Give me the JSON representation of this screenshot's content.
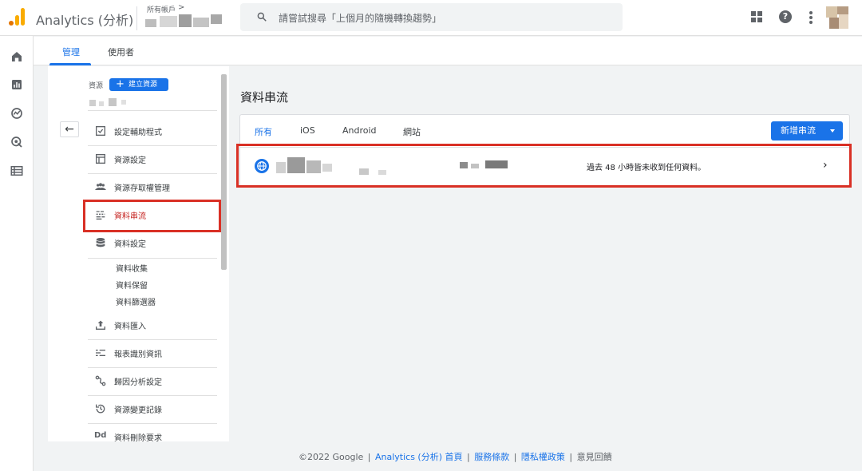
{
  "header": {
    "app_title": "Analytics (分析)",
    "account_label": "所有帳戶",
    "account_chevron": ">",
    "search_placeholder": "請嘗試搜尋「上個月的隨機轉換趨勢」"
  },
  "tabs": [
    {
      "label": "管理",
      "active": true
    },
    {
      "label": "使用者",
      "active": false
    }
  ],
  "property": {
    "label": "資源",
    "create_button": "建立資源",
    "create_icon": "+"
  },
  "back_icon": "←",
  "nav": [
    {
      "label": "設定輔助程式",
      "icon": "checklist-icon"
    },
    {
      "label": "資源設定",
      "icon": "property-settings-icon"
    },
    {
      "label": "資源存取權管理",
      "icon": "people-icon"
    },
    {
      "label": "資料串流",
      "icon": "data-streams-icon",
      "active": true
    },
    {
      "label": "資料設定",
      "icon": "database-icon"
    },
    {
      "label": "資料匯入",
      "icon": "upload-icon"
    },
    {
      "label": "報表識別資訊",
      "icon": "reporting-identity-icon"
    },
    {
      "label": "歸因分析設定",
      "icon": "attribution-icon"
    },
    {
      "label": "資源變更記錄",
      "icon": "history-icon"
    },
    {
      "label": "資料刪除要求",
      "icon": "dd-icon",
      "icon_text": "Dd"
    }
  ],
  "data_settings_sub": [
    "資料收集",
    "資料保留",
    "資料篩選器"
  ],
  "main": {
    "title": "資料串流",
    "stream_tabs": [
      "所有",
      "iOS",
      "Android",
      "網站"
    ],
    "add_stream_button": "新增串流",
    "stream_row": {
      "status": "過去 48 小時皆未收到任何資料。",
      "chevron": "›"
    }
  },
  "footer": {
    "copyright": "©2022 Google",
    "links": [
      "Analytics (分析) 首頁",
      "服務條款",
      "隱私權政策"
    ],
    "feedback": "意見回饋"
  },
  "colors": {
    "accent": "#1a73e8",
    "highlight": "#d93025",
    "active_nav": "#c5221f"
  }
}
